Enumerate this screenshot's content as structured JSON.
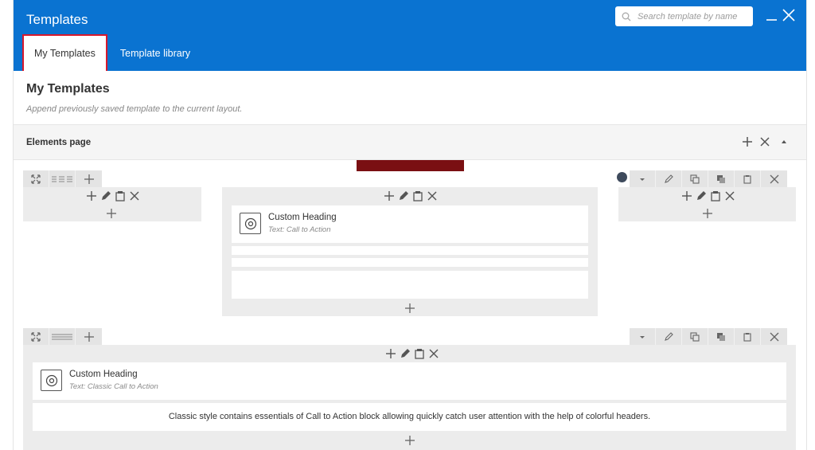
{
  "header": {
    "title": "Templates",
    "search_placeholder": "Search template by name"
  },
  "tabs": [
    {
      "label": "My Templates",
      "active": true
    },
    {
      "label": "Template library",
      "active": false
    }
  ],
  "section": {
    "title": "My Templates",
    "description": "Append previously saved template to the current layout."
  },
  "template": {
    "name": "Elements page"
  },
  "row1": {
    "center_element": {
      "title": "Custom Heading",
      "subtitle": "Text: Call to Action"
    }
  },
  "row2": {
    "element": {
      "title": "Custom Heading",
      "subtitle": "Text: Classic Call to Action"
    },
    "text_block": "Classic style contains essentials of Call to Action block allowing quickly catch user attention with the help of colorful headers."
  },
  "colors": {
    "header_bg": "#0a73d1",
    "active_tab_border": "#d8182c",
    "control_bg": "#e4e4e4",
    "column_bg": "#ececec",
    "dark_bar": "#7a0f12"
  },
  "icons": [
    "search-icon",
    "minimize-icon",
    "close-icon",
    "plus-icon",
    "pencil-icon",
    "clipboard-icon",
    "x-icon",
    "chevron-up-icon",
    "chevron-down-icon",
    "expand-icon",
    "layout-icon",
    "copy-icon",
    "paste-icon",
    "at-sign-icon"
  ]
}
